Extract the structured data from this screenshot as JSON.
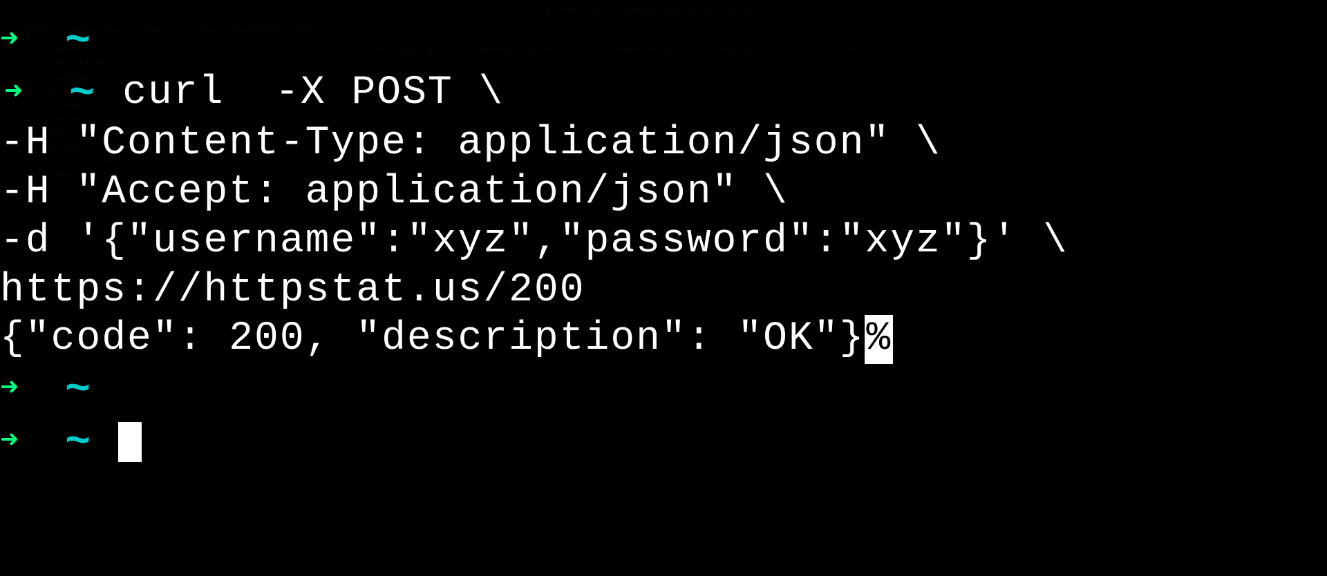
{
  "window": {
    "title": "● index.mdx - himalay.github.io - Code - OSS"
  },
  "menubar": {
    "items": [
      "Edit",
      "Selection",
      "View",
      "Go",
      "Run",
      "Terminal",
      "Help"
    ]
  },
  "bg_sidebar": {
    "header": "EXPLORER",
    "open_editors": "OPEN EDITORS",
    "items": [
      "Untitled-1",
      "index.mdx",
      ".vscode",
      "content",
      "2016-07-23-post-json-data-using-curl.md",
      "images",
      "curl-post.png",
      "index.mdx"
    ]
  },
  "bg_tabs": {
    "items": [
      "Untitled-1 ●",
      "useBootstrapPrefix",
      "● index.mdx ●",
      "rehighlight.js",
      "bin.tsx"
    ]
  },
  "terminal": {
    "prompt_arrow": "➜",
    "prompt_tilde": "~",
    "command": {
      "line1": "curl  -X POST \\",
      "line2": "-H \"Content-Type: application/json\" \\",
      "line3": "-H \"Accept: application/json\" \\",
      "line4": "-d '{\"username\":\"xyz\",\"password\":\"xyz\"}' \\",
      "line5": "https://httpstat.us/200"
    },
    "response": {
      "text": "{\"code\": 200, \"description\": \"OK\"}",
      "trail": "%"
    }
  }
}
